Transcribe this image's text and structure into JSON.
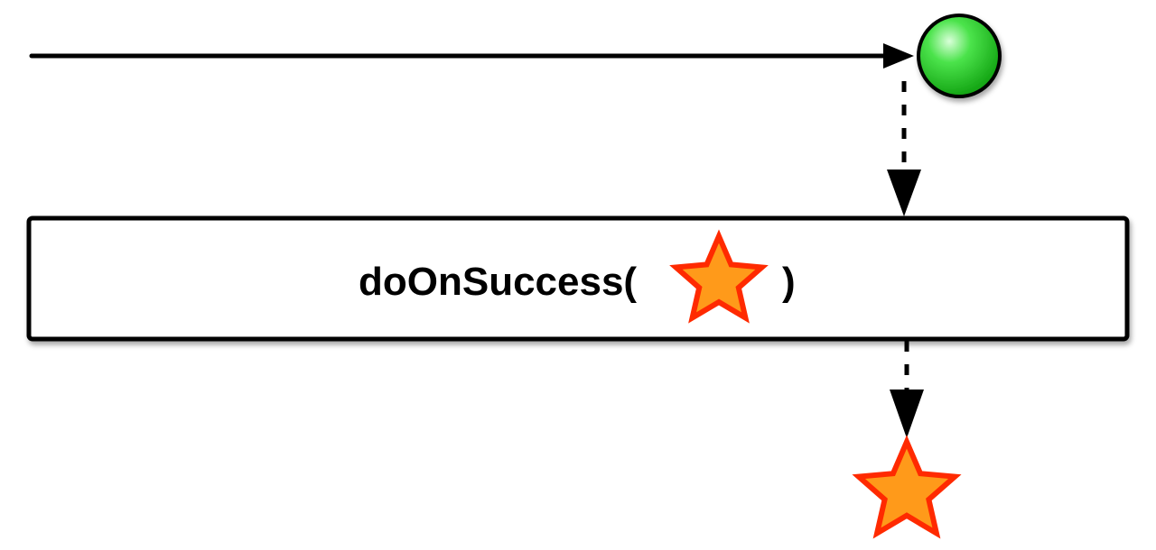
{
  "operator": {
    "name": "doOnSuccess(",
    "close": ")",
    "parameter_icon": "star-icon"
  },
  "source": {
    "item_icon": "green-circle-icon",
    "item_color": "#22cc22"
  },
  "result": {
    "item_icon": "star-icon"
  },
  "colors": {
    "star_fill": "#ff9a1a",
    "star_stroke": "#ff2a00",
    "line": "#000000",
    "box_border": "#000000",
    "box_fill": "#ffffff"
  }
}
